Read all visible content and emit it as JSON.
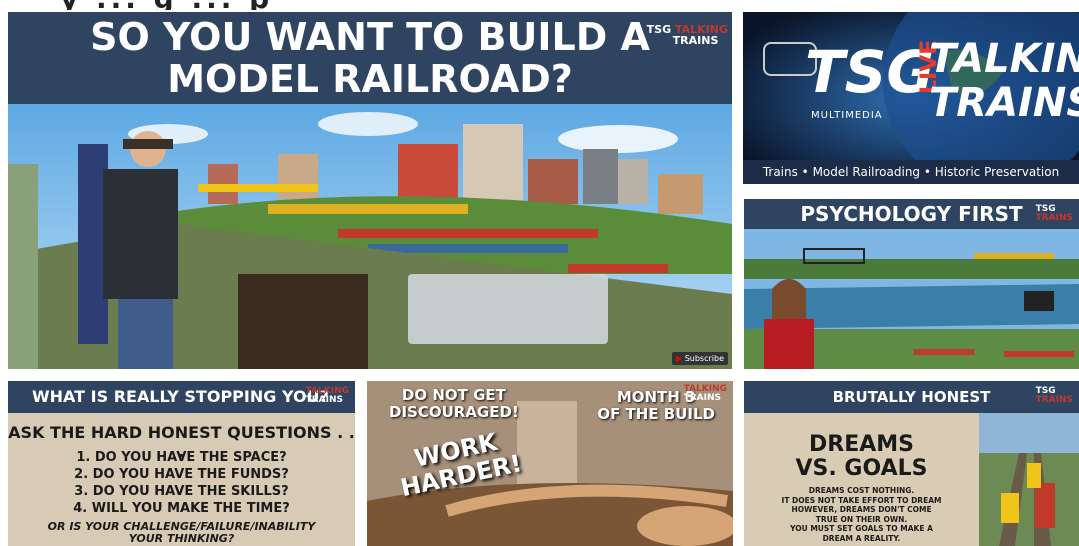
{
  "top_title_fragment": "y  ... g  ... p",
  "tiles": {
    "main": {
      "title_line1": "SO YOU WANT TO BUILD A",
      "title_line2": "MODEL RAILROAD?",
      "logo_tsg": "TSG",
      "logo_talking": "TALKING",
      "logo_trains": "TRAINS",
      "subscribe_label": "Subscribe"
    },
    "tsg_live": {
      "tsg": "TSG",
      "multimedia": "MULTIMEDIA",
      "live": "LIVE",
      "talking": "TALKING",
      "trains": "TRAINS",
      "tagline": "Trains • Model Railroading • Historic Preservation"
    },
    "psychology": {
      "title": "PSYCHOLOGY FIRST",
      "logo_tsg": "TSG",
      "logo_trains": "TRAINS"
    },
    "stopping": {
      "title": "WHAT IS REALLY STOPPING YOU?",
      "heading": "ASK THE HARD HONEST QUESTIONS . . .",
      "questions": [
        "1. DO YOU HAVE THE SPACE?",
        "2. DO YOU HAVE THE FUNDS?",
        "3. DO YOU HAVE THE SKILLS?",
        "4. WILL YOU MAKE THE TIME?"
      ],
      "footer_line1": "OR IS YOUR CHALLENGE/FAILURE/INABILITY",
      "footer_line2": "YOUR THINKING?",
      "logo_talking": "TALKING",
      "logo_trains": "TRAINS"
    },
    "discouraged": {
      "line1": "DO NOT GET",
      "line2": "DISCOURAGED!",
      "month1": "MONTH 3",
      "month2": "OF THE BUILD",
      "work": "WORK",
      "harder": "HARDER!",
      "logo_talking": "TALKING",
      "logo_trains": "TRAINS"
    },
    "honest": {
      "title": "BRUTALLY HONEST",
      "dreams": "DREAMS",
      "vs_goals": "VS. GOALS",
      "body": [
        "DREAMS COST NOTHING.",
        "IT DOES NOT TAKE EFFORT TO DREAM",
        "HOWEVER, DREAMS DON'T COME",
        "TRUE ON THEIR OWN.",
        "YOU MUST SET GOALS TO MAKE A",
        "DREAM A REALITY."
      ],
      "logo_tsg": "TSG",
      "logo_trains": "TRAINS"
    }
  },
  "colors": {
    "banner": "#2f4460",
    "board": "#d9ccb4",
    "accent_red": "#c0392b",
    "sky": "#6fb2e6"
  }
}
